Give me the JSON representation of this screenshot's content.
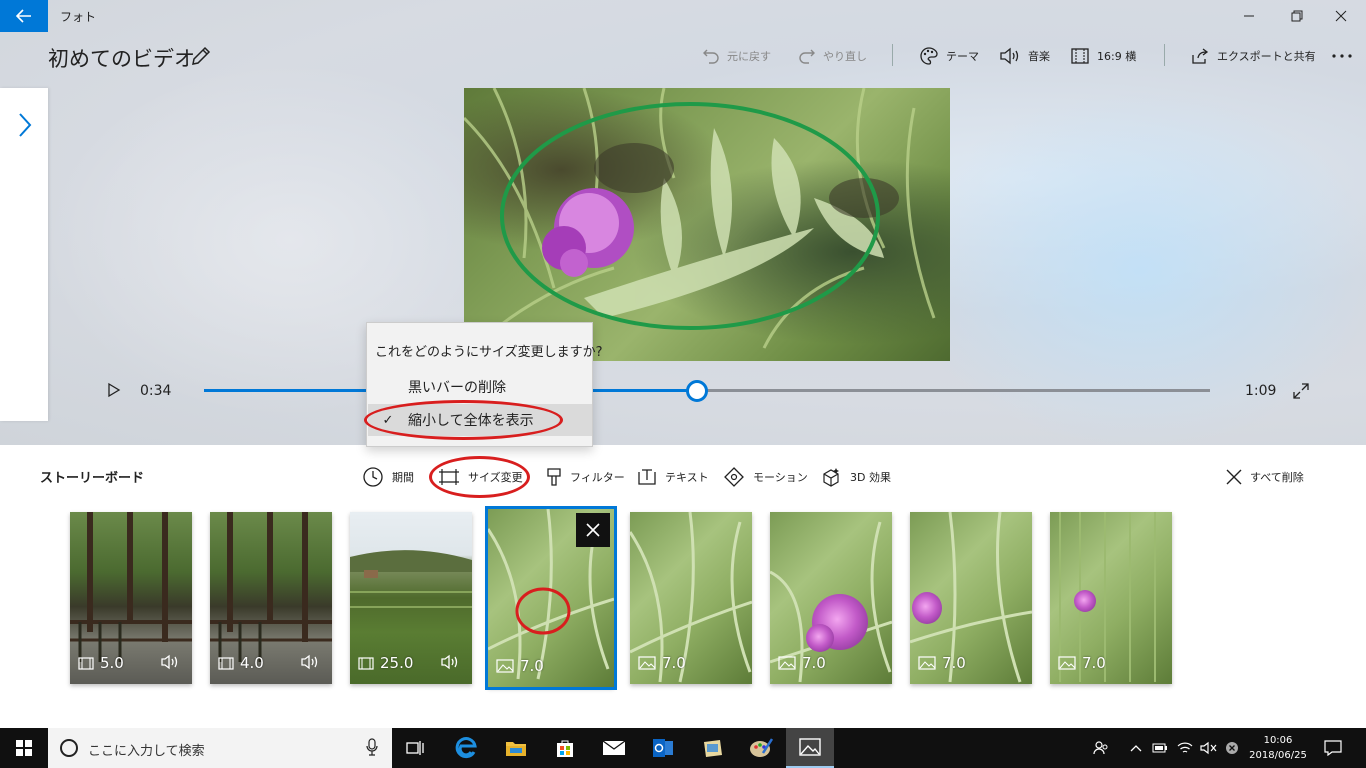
{
  "app": {
    "title": "フォト",
    "project_title": "初めてのビデオ"
  },
  "toolbar": {
    "undo": "元に戻す",
    "redo": "やり直し",
    "theme": "テーマ",
    "music": "音楽",
    "aspect": "16:9 横",
    "export": "エクスポートと共有"
  },
  "player": {
    "current_time": "0:34",
    "total_time": "1:09",
    "progress_fraction": 0.49
  },
  "resize_menu": {
    "question": "これをどのようにサイズ変更しますか?",
    "options": [
      {
        "label": "黒いバーの削除",
        "selected": false
      },
      {
        "label": "縮小して全体を表示",
        "selected": true
      }
    ],
    "check_glyph": "✓"
  },
  "storyboard": {
    "label": "ストーリーボード",
    "tools": {
      "duration": "期間",
      "resize": "サイズ変更",
      "filter": "フィルター",
      "text": "テキスト",
      "motion": "モーション",
      "effects3d": "3D 効果",
      "delete_all": "すべて削除"
    },
    "clips": [
      {
        "duration": "5.0",
        "kind": "video",
        "audio": true
      },
      {
        "duration": "4.0",
        "kind": "video",
        "audio": true
      },
      {
        "duration": "25.0",
        "kind": "video",
        "audio": true
      },
      {
        "duration": "7.0",
        "kind": "image",
        "audio": false,
        "selected": true
      },
      {
        "duration": "7.0",
        "kind": "image",
        "audio": false
      },
      {
        "duration": "7.0",
        "kind": "image",
        "audio": false
      },
      {
        "duration": "7.0",
        "kind": "image",
        "audio": false
      },
      {
        "duration": "7.0",
        "kind": "image",
        "audio": false
      }
    ]
  },
  "taskbar": {
    "search_placeholder": "ここに入力して検索",
    "time": "10:06",
    "date": "2018/06/25"
  },
  "colors": {
    "accent": "#0078d7",
    "annotation_red": "#d81e1e",
    "annotation_green": "#1f9a48"
  }
}
